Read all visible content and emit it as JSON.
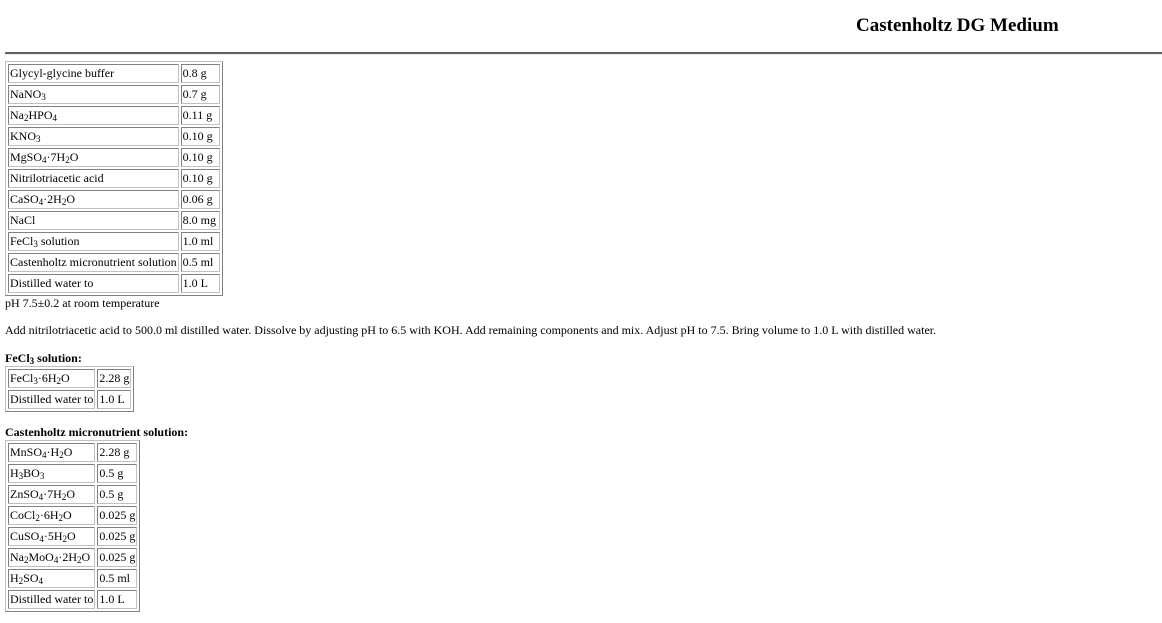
{
  "title": "Castenholtz DG Medium",
  "main_components": [
    {
      "name": "Glycyl-glycine buffer",
      "amount": "0.8 g"
    },
    {
      "name": "NaNO3",
      "amount": "0.7 g"
    },
    {
      "name": "Na2HPO4",
      "amount": "0.11 g"
    },
    {
      "name": "KNO3",
      "amount": "0.10 g"
    },
    {
      "name": "MgSO4·7H2O",
      "amount": "0.10 g"
    },
    {
      "name": "Nitrilotriacetic acid",
      "amount": "0.10 g"
    },
    {
      "name": "CaSO4·2H2O",
      "amount": "0.06 g"
    },
    {
      "name": "NaCl",
      "amount": "8.0 mg"
    },
    {
      "name": "FeCl3 solution",
      "amount": "1.0 ml"
    },
    {
      "name": "Castenholtz micronutrient solution",
      "amount": "0.5 ml"
    },
    {
      "name": "Distilled water to",
      "amount": "1.0 L"
    }
  ],
  "ph_note": "pH 7.5±0.2 at room temperature",
  "instructions": "Add nitrilotriacetic acid to 500.0 ml distilled water. Dissolve by adjusting pH to 6.5 with KOH. Add remaining components and mix. Adjust pH to 7.5. Bring volume to 1.0 L with distilled water.",
  "fecl3_solution": {
    "heading": "FeCl3 solution:",
    "components": [
      {
        "name": "FeCl3·6H2O",
        "amount": "2.28 g"
      },
      {
        "name": "Distilled water to",
        "amount": "1.0 L"
      }
    ]
  },
  "micronutrient_solution": {
    "heading": "Castenholtz micronutrient solution:",
    "components": [
      {
        "name": "MnSO4·H2O",
        "amount": "2.28 g"
      },
      {
        "name": "H3BO3",
        "amount": "0.5 g"
      },
      {
        "name": "ZnSO4·7H2O",
        "amount": "0.5 g"
      },
      {
        "name": "CoCl2·6H2O",
        "amount": "0.025 g"
      },
      {
        "name": "CuSO4·5H2O",
        "amount": "0.025 g"
      },
      {
        "name": "Na2MoO4·2H2O",
        "amount": "0.025 g"
      },
      {
        "name": "H2SO4",
        "amount": "0.5 ml"
      },
      {
        "name": "Distilled water to",
        "amount": "1.0 L"
      }
    ]
  }
}
